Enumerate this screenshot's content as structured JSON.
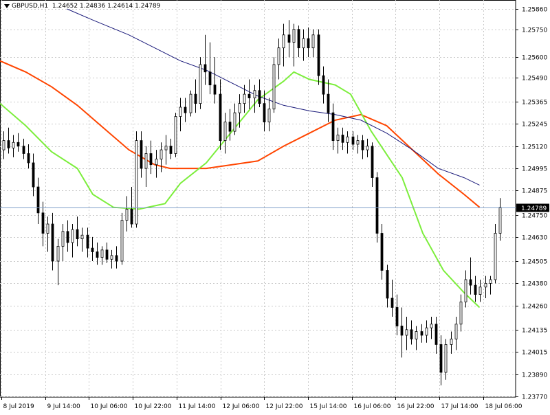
{
  "symbol": "GBPUSD,H1",
  "ohlc": "1.24652 1.24836 1.24614 1.24789",
  "current_price_label": "1.24789",
  "colors": {
    "background": "#ffffff",
    "grid": "#c8c8c8",
    "candle": "#000000",
    "current_price_line": "#7f9fc8",
    "current_price_badge": "#000000",
    "ma_fast": "#ff4500",
    "ma_mid": "#7cee3c",
    "ma_slow": "#1a1a7a"
  },
  "chart_data": {
    "type": "candlestick",
    "title": "GBPUSD,H1",
    "ylim": [
      1.2377,
      1.2586
    ],
    "grid": true,
    "y_ticks": [
      {
        "value": 1.2586,
        "label": "1.25860"
      },
      {
        "value": 1.2575,
        "label": "1.25750"
      },
      {
        "value": 1.256,
        "label": "1.25600"
      },
      {
        "value": 1.2549,
        "label": "1.25490"
      },
      {
        "value": 1.2536,
        "label": "1.25365"
      },
      {
        "value": 1.2524,
        "label": "1.25245"
      },
      {
        "value": 1.2512,
        "label": "1.25120"
      },
      {
        "value": 1.25,
        "label": "1.24995"
      },
      {
        "value": 1.2488,
        "label": "1.24875"
      },
      {
        "value": 1.2475,
        "label": "1.24750"
      },
      {
        "value": 1.2463,
        "label": "1.24630"
      },
      {
        "value": 1.245,
        "label": "1.24505"
      },
      {
        "value": 1.2438,
        "label": "1.24380"
      },
      {
        "value": 1.2426,
        "label": "1.24260"
      },
      {
        "value": 1.2413,
        "label": "1.24135"
      },
      {
        "value": 1.2401,
        "label": "1.24015"
      },
      {
        "value": 1.2389,
        "label": "1.23890"
      },
      {
        "value": 1.2377,
        "label": "1.23770"
      }
    ],
    "x_ticks": [
      "8 Jul 2019",
      "9 Jul 14:00",
      "10 Jul 06:00",
      "10 Jul 22:00",
      "11 Jul 14:00",
      "12 Jul 06:00",
      "12 Jul 22:00",
      "15 Jul 14:00",
      "16 Jul 06:00",
      "16 Jul 22:00",
      "17 Jul 14:00",
      "18 Jul 06:00"
    ],
    "current_price": 1.24789,
    "candles": [
      {
        "o": 1.251,
        "h": 1.252,
        "l": 1.2505,
        "c": 1.2515
      },
      {
        "o": 1.2515,
        "h": 1.2522,
        "l": 1.2508,
        "c": 1.2511
      },
      {
        "o": 1.2511,
        "h": 1.2518,
        "l": 1.2506,
        "c": 1.2514
      },
      {
        "o": 1.2514,
        "h": 1.2519,
        "l": 1.2509,
        "c": 1.2512
      },
      {
        "o": 1.2512,
        "h": 1.2516,
        "l": 1.2505,
        "c": 1.2508
      },
      {
        "o": 1.2508,
        "h": 1.2513,
        "l": 1.25,
        "c": 1.2503
      },
      {
        "o": 1.2503,
        "h": 1.2508,
        "l": 1.2485,
        "c": 1.249
      },
      {
        "o": 1.249,
        "h": 1.2495,
        "l": 1.247,
        "c": 1.2476
      },
      {
        "o": 1.2476,
        "h": 1.2482,
        "l": 1.2458,
        "c": 1.2465
      },
      {
        "o": 1.2465,
        "h": 1.2474,
        "l": 1.2455,
        "c": 1.247
      },
      {
        "o": 1.247,
        "h": 1.2476,
        "l": 1.2445,
        "c": 1.245
      },
      {
        "o": 1.245,
        "h": 1.2462,
        "l": 1.2437,
        "c": 1.2458
      },
      {
        "o": 1.2458,
        "h": 1.247,
        "l": 1.245,
        "c": 1.2466
      },
      {
        "o": 1.2466,
        "h": 1.2472,
        "l": 1.2455,
        "c": 1.246
      },
      {
        "o": 1.246,
        "h": 1.247,
        "l": 1.2452,
        "c": 1.2467
      },
      {
        "o": 1.2467,
        "h": 1.2474,
        "l": 1.2458,
        "c": 1.2462
      },
      {
        "o": 1.2462,
        "h": 1.2468,
        "l": 1.2455,
        "c": 1.2464
      },
      {
        "o": 1.2464,
        "h": 1.2468,
        "l": 1.2452,
        "c": 1.2457
      },
      {
        "o": 1.2457,
        "h": 1.2463,
        "l": 1.245,
        "c": 1.2455
      },
      {
        "o": 1.2455,
        "h": 1.246,
        "l": 1.2448,
        "c": 1.2452
      },
      {
        "o": 1.2452,
        "h": 1.2458,
        "l": 1.2448,
        "c": 1.2456
      },
      {
        "o": 1.2456,
        "h": 1.246,
        "l": 1.2449,
        "c": 1.2451
      },
      {
        "o": 1.2451,
        "h": 1.2456,
        "l": 1.2446,
        "c": 1.2453
      },
      {
        "o": 1.2453,
        "h": 1.2458,
        "l": 1.2446,
        "c": 1.245
      },
      {
        "o": 1.245,
        "h": 1.2476,
        "l": 1.2448,
        "c": 1.2472
      },
      {
        "o": 1.2472,
        "h": 1.2485,
        "l": 1.2466,
        "c": 1.2478
      },
      {
        "o": 1.2478,
        "h": 1.249,
        "l": 1.2468,
        "c": 1.247
      },
      {
        "o": 1.247,
        "h": 1.252,
        "l": 1.2468,
        "c": 1.2515
      },
      {
        "o": 1.2515,
        "h": 1.252,
        "l": 1.2495,
        "c": 1.25
      },
      {
        "o": 1.25,
        "h": 1.2512,
        "l": 1.249,
        "c": 1.2508
      },
      {
        "o": 1.2508,
        "h": 1.2515,
        "l": 1.2497,
        "c": 1.2502
      },
      {
        "o": 1.2502,
        "h": 1.251,
        "l": 1.2495,
        "c": 1.2505
      },
      {
        "o": 1.2505,
        "h": 1.2514,
        "l": 1.2498,
        "c": 1.251
      },
      {
        "o": 1.251,
        "h": 1.2518,
        "l": 1.2502,
        "c": 1.2512
      },
      {
        "o": 1.2512,
        "h": 1.2516,
        "l": 1.2505,
        "c": 1.2508
      },
      {
        "o": 1.2508,
        "h": 1.253,
        "l": 1.2506,
        "c": 1.2528
      },
      {
        "o": 1.2528,
        "h": 1.2538,
        "l": 1.252,
        "c": 1.2533
      },
      {
        "o": 1.2533,
        "h": 1.2538,
        "l": 1.2525,
        "c": 1.253
      },
      {
        "o": 1.253,
        "h": 1.2542,
        "l": 1.2528,
        "c": 1.254
      },
      {
        "o": 1.254,
        "h": 1.2548,
        "l": 1.253,
        "c": 1.2535
      },
      {
        "o": 1.2535,
        "h": 1.256,
        "l": 1.2532,
        "c": 1.2556
      },
      {
        "o": 1.2556,
        "h": 1.2572,
        "l": 1.2545,
        "c": 1.2552
      },
      {
        "o": 1.2552,
        "h": 1.2568,
        "l": 1.254,
        "c": 1.2545
      },
      {
        "o": 1.2545,
        "h": 1.256,
        "l": 1.2535,
        "c": 1.254
      },
      {
        "o": 1.254,
        "h": 1.2548,
        "l": 1.251,
        "c": 1.2515
      },
      {
        "o": 1.2515,
        "h": 1.253,
        "l": 1.2508,
        "c": 1.2525
      },
      {
        "o": 1.2525,
        "h": 1.2532,
        "l": 1.2515,
        "c": 1.252
      },
      {
        "o": 1.252,
        "h": 1.2535,
        "l": 1.2518,
        "c": 1.253
      },
      {
        "o": 1.253,
        "h": 1.254,
        "l": 1.2522,
        "c": 1.2535
      },
      {
        "o": 1.2535,
        "h": 1.2545,
        "l": 1.253,
        "c": 1.254
      },
      {
        "o": 1.254,
        "h": 1.2548,
        "l": 1.2532,
        "c": 1.2538
      },
      {
        "o": 1.2538,
        "h": 1.2545,
        "l": 1.253,
        "c": 1.2542
      },
      {
        "o": 1.2542,
        "h": 1.2548,
        "l": 1.2533,
        "c": 1.2535
      },
      {
        "o": 1.2535,
        "h": 1.2542,
        "l": 1.252,
        "c": 1.2525
      },
      {
        "o": 1.2525,
        "h": 1.2538,
        "l": 1.252,
        "c": 1.2532
      },
      {
        "o": 1.2532,
        "h": 1.256,
        "l": 1.253,
        "c": 1.2556
      },
      {
        "o": 1.2556,
        "h": 1.257,
        "l": 1.2548,
        "c": 1.2565
      },
      {
        "o": 1.2565,
        "h": 1.2578,
        "l": 1.2555,
        "c": 1.2572
      },
      {
        "o": 1.2572,
        "h": 1.258,
        "l": 1.256,
        "c": 1.2568
      },
      {
        "o": 1.2568,
        "h": 1.2578,
        "l": 1.2555,
        "c": 1.2575
      },
      {
        "o": 1.2575,
        "h": 1.2577,
        "l": 1.256,
        "c": 1.2565
      },
      {
        "o": 1.2565,
        "h": 1.2575,
        "l": 1.2558,
        "c": 1.257
      },
      {
        "o": 1.257,
        "h": 1.2576,
        "l": 1.256,
        "c": 1.2565
      },
      {
        "o": 1.2565,
        "h": 1.2575,
        "l": 1.256,
        "c": 1.2572
      },
      {
        "o": 1.2572,
        "h": 1.2575,
        "l": 1.2545,
        "c": 1.255
      },
      {
        "o": 1.255,
        "h": 1.2555,
        "l": 1.2535,
        "c": 1.254
      },
      {
        "o": 1.254,
        "h": 1.2548,
        "l": 1.2525,
        "c": 1.253
      },
      {
        "o": 1.253,
        "h": 1.2535,
        "l": 1.251,
        "c": 1.2515
      },
      {
        "o": 1.2515,
        "h": 1.2522,
        "l": 1.2508,
        "c": 1.2518
      },
      {
        "o": 1.2518,
        "h": 1.2522,
        "l": 1.251,
        "c": 1.2514
      },
      {
        "o": 1.2514,
        "h": 1.252,
        "l": 1.2508,
        "c": 1.2517
      },
      {
        "o": 1.2517,
        "h": 1.252,
        "l": 1.251,
        "c": 1.2513
      },
      {
        "o": 1.2513,
        "h": 1.2518,
        "l": 1.2508,
        "c": 1.2515
      },
      {
        "o": 1.2515,
        "h": 1.2518,
        "l": 1.2505,
        "c": 1.251
      },
      {
        "o": 1.251,
        "h": 1.2516,
        "l": 1.2506,
        "c": 1.2512
      },
      {
        "o": 1.2512,
        "h": 1.2514,
        "l": 1.249,
        "c": 1.2495
      },
      {
        "o": 1.2495,
        "h": 1.2498,
        "l": 1.246,
        "c": 1.2465
      },
      {
        "o": 1.2465,
        "h": 1.247,
        "l": 1.244,
        "c": 1.2445
      },
      {
        "o": 1.2445,
        "h": 1.2448,
        "l": 1.2425,
        "c": 1.243
      },
      {
        "o": 1.243,
        "h": 1.244,
        "l": 1.242,
        "c": 1.2425
      },
      {
        "o": 1.2425,
        "h": 1.2432,
        "l": 1.241,
        "c": 1.2415
      },
      {
        "o": 1.2415,
        "h": 1.2425,
        "l": 1.2398,
        "c": 1.241
      },
      {
        "o": 1.241,
        "h": 1.242,
        "l": 1.2402,
        "c": 1.2413
      },
      {
        "o": 1.2413,
        "h": 1.2418,
        "l": 1.2405,
        "c": 1.2408
      },
      {
        "o": 1.2408,
        "h": 1.2415,
        "l": 1.2402,
        "c": 1.2412
      },
      {
        "o": 1.2412,
        "h": 1.2416,
        "l": 1.2406,
        "c": 1.241
      },
      {
        "o": 1.241,
        "h": 1.2418,
        "l": 1.2406,
        "c": 1.2414
      },
      {
        "o": 1.2414,
        "h": 1.242,
        "l": 1.2408,
        "c": 1.2416
      },
      {
        "o": 1.2416,
        "h": 1.242,
        "l": 1.24,
        "c": 1.2405
      },
      {
        "o": 1.2405,
        "h": 1.241,
        "l": 1.2383,
        "c": 1.239
      },
      {
        "o": 1.239,
        "h": 1.2408,
        "l": 1.2386,
        "c": 1.2405
      },
      {
        "o": 1.2405,
        "h": 1.2412,
        "l": 1.24,
        "c": 1.2408
      },
      {
        "o": 1.2408,
        "h": 1.242,
        "l": 1.2402,
        "c": 1.2416
      },
      {
        "o": 1.2416,
        "h": 1.2432,
        "l": 1.2412,
        "c": 1.2428
      },
      {
        "o": 1.2428,
        "h": 1.2445,
        "l": 1.2425,
        "c": 1.244
      },
      {
        "o": 1.244,
        "h": 1.2452,
        "l": 1.2432,
        "c": 1.2437
      },
      {
        "o": 1.2437,
        "h": 1.2442,
        "l": 1.2428,
        "c": 1.2432
      },
      {
        "o": 1.2432,
        "h": 1.244,
        "l": 1.2428,
        "c": 1.2436
      },
      {
        "o": 1.2436,
        "h": 1.2442,
        "l": 1.243,
        "c": 1.2438
      },
      {
        "o": 1.2438,
        "h": 1.2442,
        "l": 1.2432,
        "c": 1.244
      },
      {
        "o": 1.244,
        "h": 1.247,
        "l": 1.2438,
        "c": 1.2465
      },
      {
        "o": 1.2465,
        "h": 1.2484,
        "l": 1.2461,
        "c": 1.2479
      }
    ],
    "series": [
      {
        "role": "ma_fast",
        "values": [
          [
            0,
            1.2558
          ],
          [
            0.05,
            1.2552
          ],
          [
            0.1,
            1.2544
          ],
          [
            0.15,
            1.2534
          ],
          [
            0.2,
            1.2522
          ],
          [
            0.25,
            1.251
          ],
          [
            0.3,
            1.2502
          ],
          [
            0.33,
            1.25
          ],
          [
            0.4,
            1.25
          ],
          [
            0.45,
            1.2502
          ],
          [
            0.5,
            1.2504
          ],
          [
            0.55,
            1.2512
          ],
          [
            0.6,
            1.2519
          ],
          [
            0.65,
            1.2526
          ],
          [
            0.7,
            1.2529
          ],
          [
            0.75,
            1.2523
          ],
          [
            0.8,
            1.251
          ],
          [
            0.85,
            1.2497
          ],
          [
            0.9,
            1.2486
          ],
          [
            0.93,
            1.2479
          ]
        ]
      },
      {
        "role": "ma_mid",
        "values": [
          [
            0,
            1.2535
          ],
          [
            0.05,
            1.2523
          ],
          [
            0.1,
            1.2509
          ],
          [
            0.15,
            1.25
          ],
          [
            0.18,
            1.2486
          ],
          [
            0.22,
            1.2479
          ],
          [
            0.27,
            1.2478
          ],
          [
            0.32,
            1.2481
          ],
          [
            0.35,
            1.2492
          ],
          [
            0.4,
            1.2503
          ],
          [
            0.45,
            1.252
          ],
          [
            0.5,
            1.2537
          ],
          [
            0.55,
            1.2547
          ],
          [
            0.57,
            1.2552
          ],
          [
            0.6,
            1.2548
          ],
          [
            0.65,
            1.2545
          ],
          [
            0.68,
            1.254
          ],
          [
            0.72,
            1.252
          ],
          [
            0.78,
            1.2495
          ],
          [
            0.82,
            1.2465
          ],
          [
            0.86,
            1.2445
          ],
          [
            0.9,
            1.2433
          ],
          [
            0.93,
            1.2425
          ]
        ]
      },
      {
        "role": "ma_slow",
        "values": [
          [
            0.13,
            1.2586
          ],
          [
            0.18,
            1.258
          ],
          [
            0.25,
            1.2572
          ],
          [
            0.3,
            1.2565
          ],
          [
            0.35,
            1.2558
          ],
          [
            0.4,
            1.2553
          ],
          [
            0.45,
            1.2546
          ],
          [
            0.5,
            1.2539
          ],
          [
            0.55,
            1.2534
          ],
          [
            0.6,
            1.2531
          ],
          [
            0.65,
            1.2529
          ],
          [
            0.7,
            1.2526
          ],
          [
            0.75,
            1.2519
          ],
          [
            0.8,
            1.251
          ],
          [
            0.85,
            1.25
          ],
          [
            0.9,
            1.2495
          ],
          [
            0.93,
            1.2491
          ]
        ]
      }
    ]
  }
}
